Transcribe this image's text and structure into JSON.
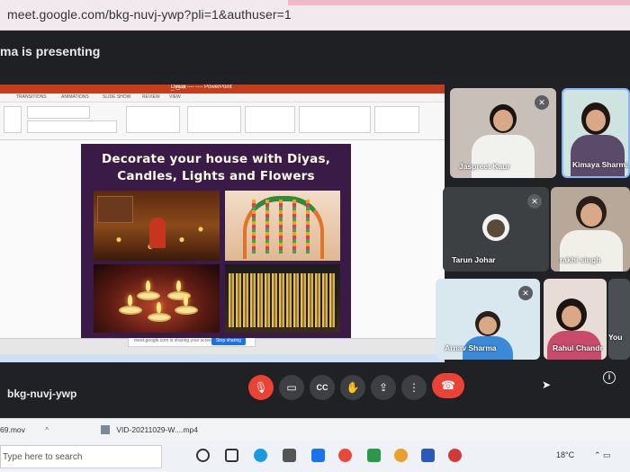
{
  "browser": {
    "url": "meet.google.com/bkg-nuvj-ywp?pli=1&authuser=1"
  },
  "meet": {
    "presenting_text": "ma is presenting",
    "meeting_code": "bkg-nuvj-ywp",
    "controls": [
      {
        "name": "mic-off",
        "icon": "mic-off-icon"
      },
      {
        "name": "camera",
        "icon": "camera-icon"
      },
      {
        "name": "captions",
        "icon": "cc-icon",
        "label": "CC"
      },
      {
        "name": "raise-hand",
        "icon": "hand-icon"
      },
      {
        "name": "present",
        "icon": "present-icon"
      },
      {
        "name": "more",
        "icon": "more-vert-icon"
      },
      {
        "name": "end-call",
        "icon": "end-call-icon"
      }
    ],
    "participants": [
      {
        "name": "Jaspreet Kaur",
        "muted": true
      },
      {
        "name": "Kimaya Sharma",
        "muted": false
      },
      {
        "name": "Tarun Johar",
        "muted": true
      },
      {
        "name": "rakhi singh",
        "muted": false
      },
      {
        "name": "Arnav Sharma",
        "muted": true
      },
      {
        "name": "Rahul Chandr",
        "muted": false
      },
      {
        "name": "You",
        "muted": false
      }
    ]
  },
  "slide": {
    "title_line1": "Decorate your house with Diyas,",
    "title_line2": "Candles, Lights and Flowers"
  },
  "shared_share_bar": {
    "text": "meet.google.com is sharing your screen.",
    "button": "Stop sharing"
  },
  "downloads": [
    {
      "name": "69.mov"
    },
    {
      "name": "VID-20211029-W....mp4"
    }
  ],
  "taskbar": {
    "search_placeholder": "Type here to search",
    "temperature": "18°C"
  },
  "colors": {
    "meet_bg": "#202124",
    "end_call": "#ea4335",
    "powerpoint": "#c43e1c",
    "slide_bg": "#3a1a46"
  }
}
